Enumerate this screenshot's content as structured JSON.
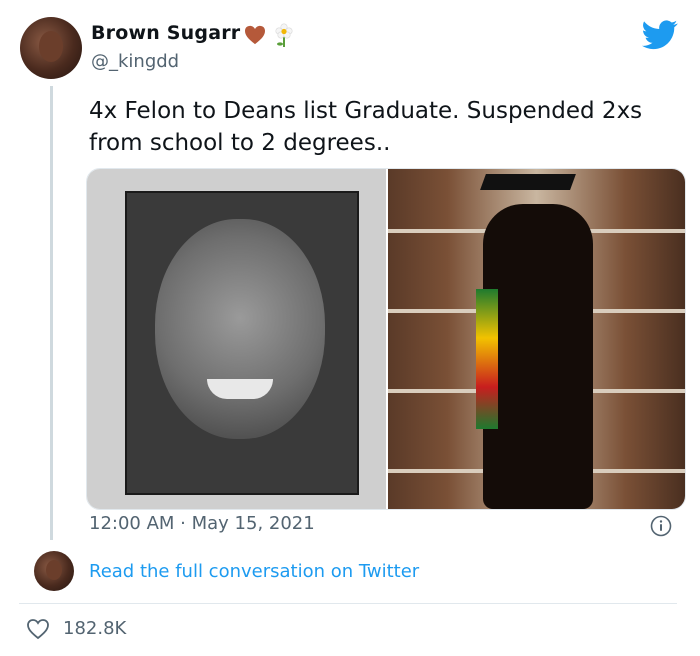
{
  "tweet": {
    "author_name": "Brown Sugarr",
    "handle": "@_kingdd",
    "text": "4x Felon to Deans list Graduate. Suspended 2xs from school to 2 degrees..",
    "timestamp": "12:00 AM · May 15, 2021",
    "read_conversation_label": "Read the full conversation on Twitter",
    "likes": "182.8K"
  },
  "icons": {
    "heart_emoji": "heart-emoji-icon",
    "flower_emoji": "flower-emoji-icon",
    "platform_logo": "twitter-bird-icon",
    "info": "info-icon",
    "like": "like-heart-icon"
  },
  "colors": {
    "accent": "#1d9bf0",
    "secondary_text": "#536471",
    "heart_emoji": "#b5593a"
  }
}
